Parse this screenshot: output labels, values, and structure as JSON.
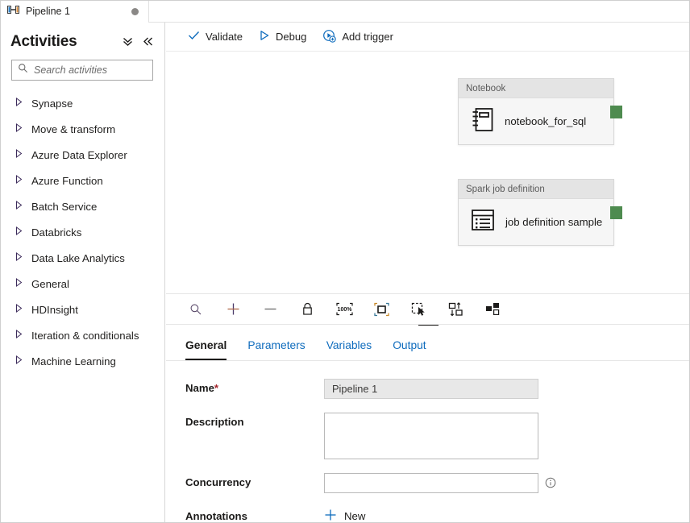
{
  "window": {
    "tab": {
      "icon": "pipeline-icon",
      "label": "Pipeline 1",
      "dirty_indicator": "unsaved-dot"
    }
  },
  "sidebar": {
    "title": "Activities",
    "collapse_all_icon": "double-chevron-down-icon",
    "collapse_panel_icon": "double-chevron-left-icon",
    "search": {
      "icon": "search-icon",
      "placeholder": "Search activities",
      "value": ""
    },
    "items": [
      {
        "label": "Synapse",
        "icon": "expand-triangle-icon"
      },
      {
        "label": "Move & transform",
        "icon": "expand-triangle-icon"
      },
      {
        "label": "Azure Data Explorer",
        "icon": "expand-triangle-icon"
      },
      {
        "label": "Azure Function",
        "icon": "expand-triangle-icon"
      },
      {
        "label": "Batch Service",
        "icon": "expand-triangle-icon"
      },
      {
        "label": "Databricks",
        "icon": "expand-triangle-icon"
      },
      {
        "label": "Data Lake Analytics",
        "icon": "expand-triangle-icon"
      },
      {
        "label": "General",
        "icon": "expand-triangle-icon"
      },
      {
        "label": "HDInsight",
        "icon": "expand-triangle-icon"
      },
      {
        "label": "Iteration & conditionals",
        "icon": "expand-triangle-icon"
      },
      {
        "label": "Machine Learning",
        "icon": "expand-triangle-icon"
      }
    ]
  },
  "canvas": {
    "toolbar": [
      {
        "label": "Validate",
        "icon": "checkmark-icon"
      },
      {
        "label": "Debug",
        "icon": "play-triangle-icon"
      },
      {
        "label": "Add trigger",
        "icon": "add-trigger-icon"
      }
    ],
    "nodes": [
      {
        "type": "Notebook",
        "name": "notebook_for_sql",
        "icon": "notebook-icon",
        "connector_color": "#4e8b4f"
      },
      {
        "type": "Spark job definition",
        "name": "job definition sample",
        "icon": "spark-job-definition-icon",
        "connector_color": "#4e8b4f"
      }
    ],
    "zoom_tools": [
      {
        "icon": "zoom-search-icon",
        "name": "zoom-to-search"
      },
      {
        "icon": "plus-icon",
        "name": "zoom-in"
      },
      {
        "icon": "minus-icon",
        "name": "zoom-out"
      },
      {
        "icon": "lock-icon",
        "name": "lock-canvas"
      },
      {
        "icon": "zoom-100-percent-icon",
        "name": "reset-zoom",
        "label": "100%"
      },
      {
        "icon": "fit-to-screen-icon",
        "name": "fit-to-screen"
      },
      {
        "icon": "marquee-select-icon",
        "name": "marquee-select"
      },
      {
        "icon": "auto-align-icon",
        "name": "auto-align"
      },
      {
        "icon": "auto-layout-icon",
        "name": "auto-layout"
      }
    ],
    "drag_handle": "splitter-drag-handle"
  },
  "properties": {
    "tabs": [
      {
        "label": "General",
        "active": true
      },
      {
        "label": "Parameters",
        "active": false
      },
      {
        "label": "Variables",
        "active": false
      },
      {
        "label": "Output",
        "active": false
      }
    ],
    "fields": {
      "name": {
        "label": "Name",
        "required_marker": "*",
        "value": "Pipeline 1",
        "placeholder": ""
      },
      "description": {
        "label": "Description",
        "value": "",
        "placeholder": ""
      },
      "concurrency": {
        "label": "Concurrency",
        "value": "",
        "placeholder": "",
        "info_icon": "info-icon"
      },
      "annotations": {
        "label": "Annotations",
        "new_label": "New",
        "new_icon": "plus-icon"
      }
    }
  },
  "colors": {
    "accent_blue": "#0f6cbd",
    "required_red": "#a4262c",
    "connector_green": "#4e8b4f",
    "node_header_gray": "#e4e4e4"
  }
}
